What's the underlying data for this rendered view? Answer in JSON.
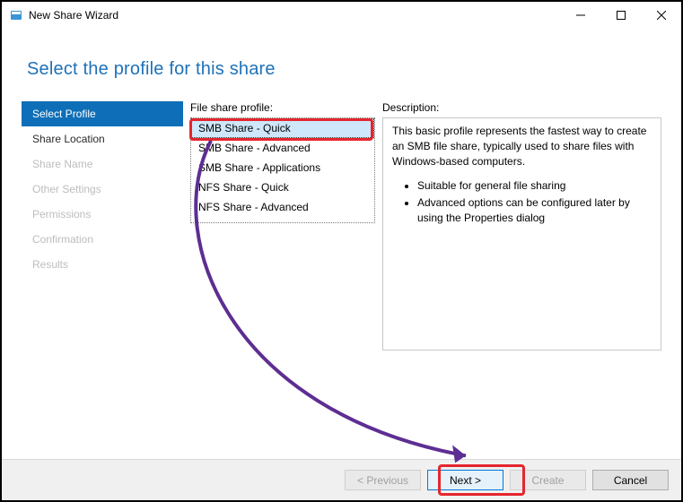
{
  "titlebar": {
    "title": "New Share Wizard"
  },
  "heading": "Select the profile for this share",
  "sidebar": {
    "steps": [
      {
        "label": "Select Profile",
        "state": "active"
      },
      {
        "label": "Share Location",
        "state": "normal"
      },
      {
        "label": "Share Name",
        "state": "disabled"
      },
      {
        "label": "Other Settings",
        "state": "disabled"
      },
      {
        "label": "Permissions",
        "state": "disabled"
      },
      {
        "label": "Confirmation",
        "state": "disabled"
      },
      {
        "label": "Results",
        "state": "disabled"
      }
    ]
  },
  "middle": {
    "label": "File share profile:",
    "items": [
      {
        "label": "SMB Share - Quick",
        "selected": true
      },
      {
        "label": "SMB Share - Advanced",
        "selected": false
      },
      {
        "label": "SMB Share - Applications",
        "selected": false
      },
      {
        "label": "NFS Share - Quick",
        "selected": false
      },
      {
        "label": "NFS Share - Advanced",
        "selected": false
      }
    ]
  },
  "right": {
    "label": "Description:",
    "paragraph": "This basic profile represents the fastest way to create an SMB file share, typically used to share files with Windows-based computers.",
    "bullets": [
      "Suitable for general file sharing",
      "Advanced options can be configured later by using the Properties dialog"
    ]
  },
  "footer": {
    "previous": "< Previous",
    "next": "Next >",
    "create": "Create",
    "cancel": "Cancel"
  }
}
